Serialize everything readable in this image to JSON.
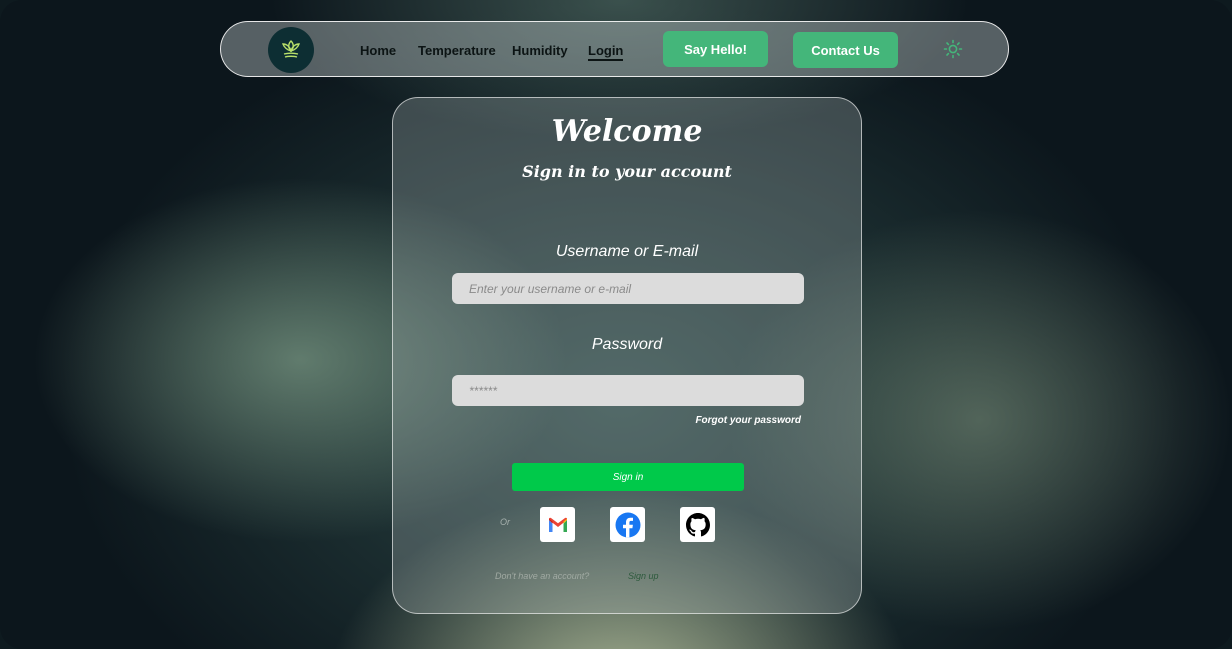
{
  "nav": {
    "links": [
      "Home",
      "Temperature",
      "Humidity",
      "Login"
    ],
    "active": "Login",
    "say_hello_label": "Say Hello!",
    "contact_label": "Contact Us",
    "accent_color": "#44b67a"
  },
  "card": {
    "title": "Welcome",
    "subtitle": "Sign in to your account",
    "username_label": "Username or E-mail",
    "username_placeholder": "Enter your username or e-mail",
    "password_label": "Password",
    "password_placeholder": "******",
    "forgot_label": "Forgot your password",
    "signin_label": "Sign in",
    "or_label": "Or",
    "no_account_label": "Don't have an account?",
    "signup_label": "Sign up",
    "signin_color": "#00c94a"
  },
  "icons": {
    "logo": "leaf-logo-icon",
    "theme": "sun-icon",
    "social": [
      "gmail-icon",
      "facebook-icon",
      "github-icon"
    ]
  }
}
